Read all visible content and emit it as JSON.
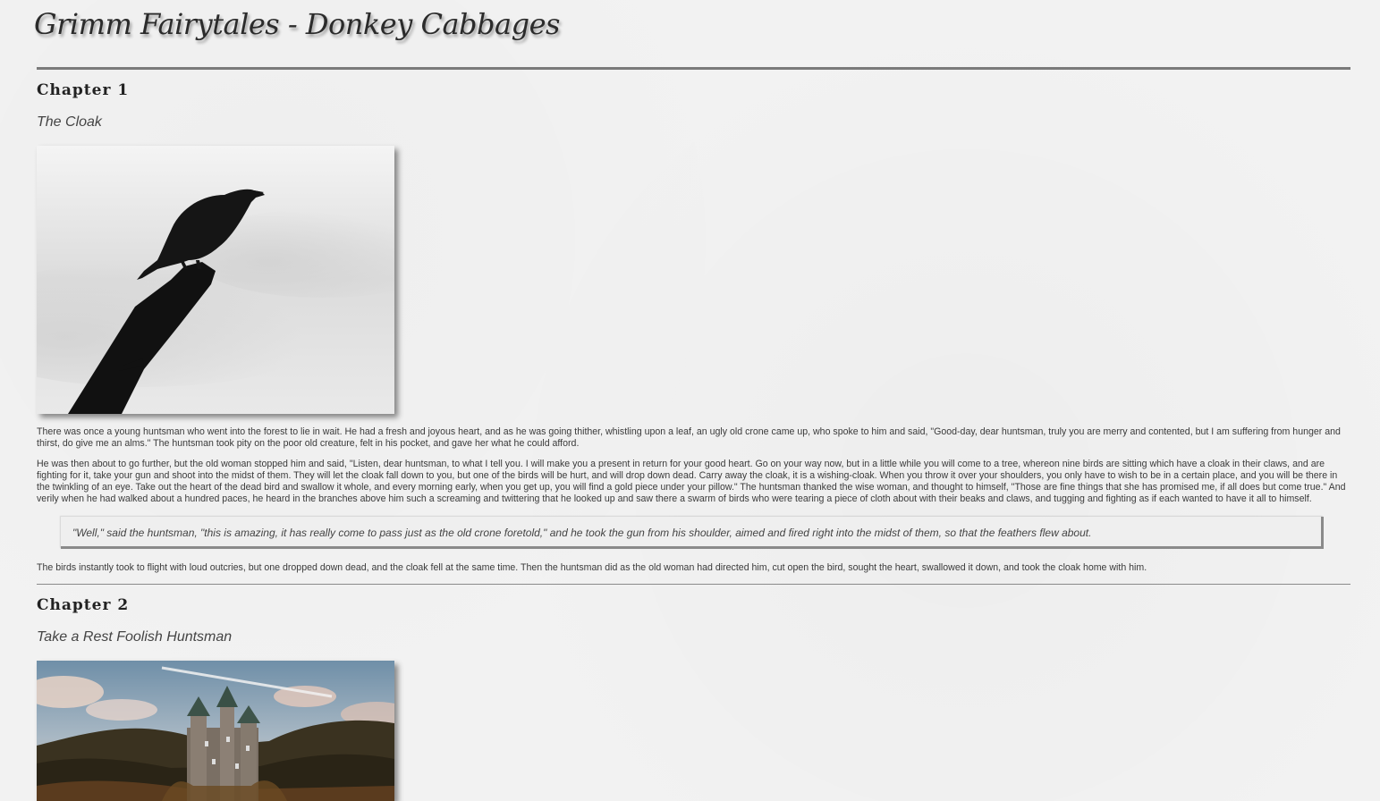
{
  "site": {
    "title": "Grimm Fairytales - Donkey Cabbages"
  },
  "chapters": [
    {
      "heading": "Chapter 1",
      "subtitle": "The Cloak",
      "image": "crow-on-branch-photo",
      "paragraphs": [
        "There was once a young huntsman who went into the forest to lie in wait. He had a fresh and joyous heart, and as he was going thither, whistling upon a leaf, an ugly old crone came up, who spoke to him and said, \"Good-day, dear huntsman, truly you are merry and contented, but I am suffering from hunger and thirst, do give me an alms.\" The huntsman took pity on the poor old creature, felt in his pocket, and gave her what he could afford.",
        "He was then about to go further, but the old woman stopped him and said, \"Listen, dear huntsman, to what I tell you. I will make you a present in return for your good heart. Go on your way now, but in a little while you will come to a tree, whereon nine birds are sitting which have a cloak in their claws, and are fighting for it, take your gun and shoot into the midst of them. They will let the cloak fall down to you, but one of the birds will be hurt, and will drop down dead. Carry away the cloak, it is a wishing-cloak. When you throw it over your shoulders, you only have to wish to be in a certain place, and you will be there in the twinkling of an eye. Take out the heart of the dead bird and swallow it whole, and every morning early, when you get up, you will find a gold piece under your pillow.\" The huntsman thanked the wise woman, and thought to himself, \"Those are fine things that she has promised me, if all does but come true.\" And verily when he had walked about a hundred paces, he heard in the branches above him such a screaming and twittering that he looked up and saw there a swarm of birds who were tearing a piece of cloth about with their beaks and claws, and tugging and fighting as if each wanted to have it all to himself."
      ],
      "quote": "\"Well,\" said the huntsman, \"this is amazing, it has really come to pass just as the old crone foretold,\" and he took the gun from his shoulder, aimed and fired right into the midst of them, so that the feathers flew about.",
      "closing": "The birds instantly took to flight with loud outcries, but one dropped down dead, and the cloak fell at the same time. Then the huntsman did as the old woman had directed him, cut open the bird, sought the heart, swallowed it down, and took the cloak home with him."
    },
    {
      "heading": "Chapter 2",
      "subtitle": "Take a Rest Foolish Huntsman",
      "image": "castle-in-forest-photo"
    }
  ]
}
